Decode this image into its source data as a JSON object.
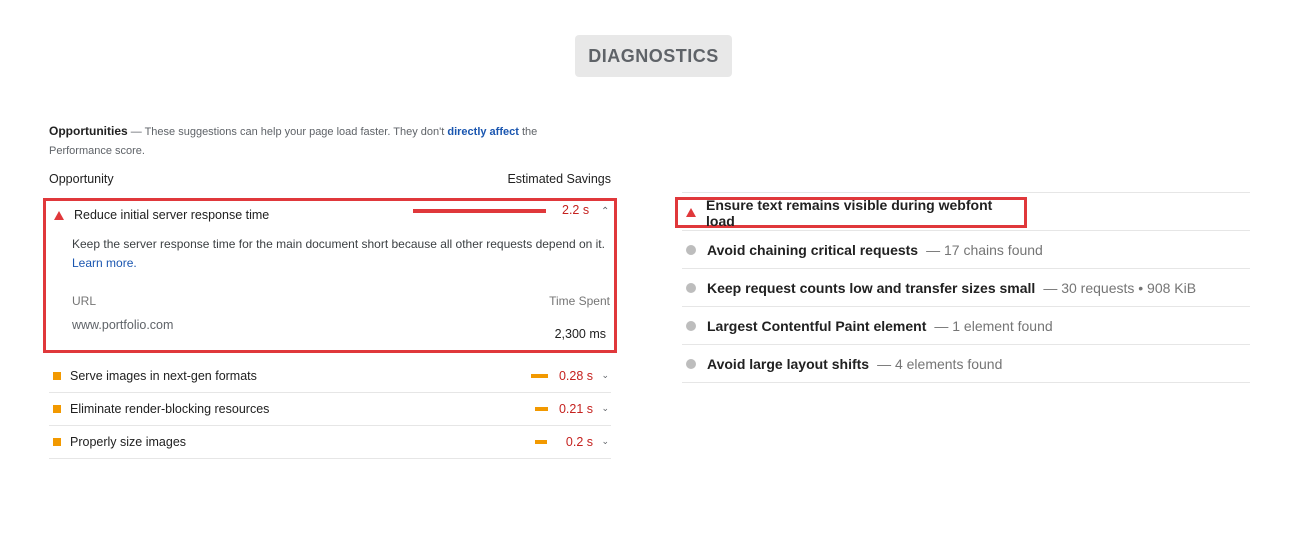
{
  "badge": "DIAGNOSTICS",
  "opportunities": {
    "title": "Opportunities",
    "desc_prefix": " — These suggestions can help your page load faster. They don't ",
    "link": "directly affect",
    "desc_suffix": " the",
    "desc_line2": "Performance score.",
    "col_left": "Opportunity",
    "col_right": "Estimated Savings",
    "expanded": {
      "title": "Reduce initial server response time",
      "value": "2.2 s",
      "description": "Keep the server response time for the main document short because all other requests depend on it. ",
      "learn_more": "Learn more.",
      "url_header": "URL",
      "time_header": "Time Spent",
      "url": "www.portfolio.com",
      "time": "2,300 ms"
    },
    "items": [
      {
        "title": "Serve images in next-gen formats",
        "value": "0.28 s"
      },
      {
        "title": "Eliminate render-blocking resources",
        "value": "0.21 s"
      },
      {
        "title": "Properly size images",
        "value": "0.2 s"
      }
    ]
  },
  "diagnostics": {
    "highlighted": "Ensure text remains visible during webfont load",
    "items": [
      {
        "name": "Avoid chaining critical requests",
        "extra": "— 17 chains found"
      },
      {
        "name": "Keep request counts low and transfer sizes small",
        "extra": "— 30 requests • 908 KiB"
      },
      {
        "name": "Largest Contentful Paint element",
        "extra": "— 1 element found"
      },
      {
        "name": "Avoid large layout shifts",
        "extra": "— 4 elements found"
      }
    ]
  },
  "colors": {
    "fail": "#e0383b",
    "average": "#f29900",
    "link": "#1a56b0"
  },
  "icons": {
    "fail": "red-triangle-icon",
    "average": "orange-square-icon",
    "info": "gray-circle-icon",
    "expand": "chevron-down-icon",
    "collapse": "chevron-up-icon"
  }
}
